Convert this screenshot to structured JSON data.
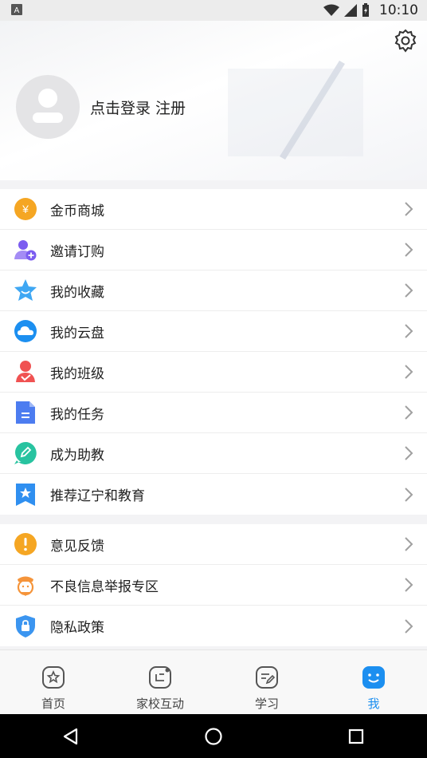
{
  "status_bar": {
    "time": "10:10",
    "notification_badge": "A"
  },
  "profile": {
    "login_text": "点击登录 注册"
  },
  "menu_group_1": [
    {
      "label": "金币商城",
      "icon": "coin-icon",
      "color": "#f5a623"
    },
    {
      "label": "邀请订购",
      "icon": "invite-user-icon",
      "color": "#7b5cf0"
    },
    {
      "label": "我的收藏",
      "icon": "star-icon",
      "color": "#3fa7f3"
    },
    {
      "label": "我的云盘",
      "icon": "cloud-icon",
      "color": "#1c8ff0"
    },
    {
      "label": "我的班级",
      "icon": "class-icon",
      "color": "#f05252"
    },
    {
      "label": "我的任务",
      "icon": "task-document-icon",
      "color": "#4c7cf0"
    },
    {
      "label": "成为助教",
      "icon": "assistant-pen-icon",
      "color": "#28c3a0"
    },
    {
      "label": "推荐辽宁和教育",
      "icon": "recommend-bookmark-icon",
      "color": "#2f8ff0"
    }
  ],
  "menu_group_2": [
    {
      "label": "意见反馈",
      "icon": "feedback-exclamation-icon",
      "color": "#f5a623"
    },
    {
      "label": "不良信息举报专区",
      "icon": "police-report-icon",
      "color": "#f5943a"
    },
    {
      "label": "隐私政策",
      "icon": "privacy-lock-icon",
      "color": "#3b95f0"
    }
  ],
  "tabs": [
    {
      "label": "首页",
      "icon": "home-star-icon"
    },
    {
      "label": "家校互动",
      "icon": "interaction-icon"
    },
    {
      "label": "学习",
      "icon": "study-pen-icon"
    },
    {
      "label": "我",
      "icon": "me-smile-icon",
      "active": true
    }
  ]
}
